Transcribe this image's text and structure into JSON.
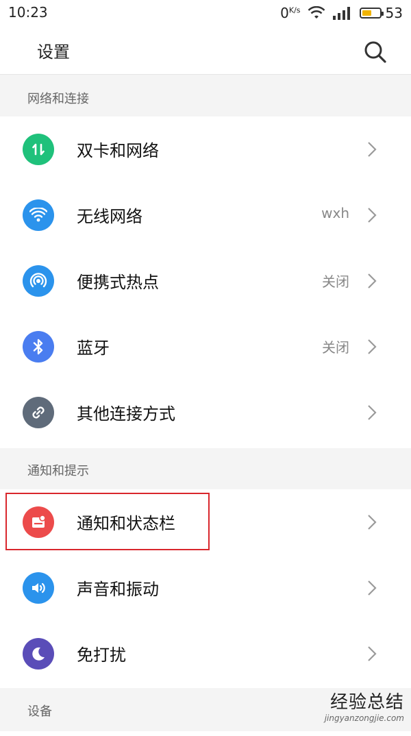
{
  "status_bar": {
    "time": "10:23",
    "network_speed": "0",
    "network_unit": "K/s",
    "battery_level": "53",
    "battery_fraction": 0.53,
    "battery_color": "#f1b400"
  },
  "header": {
    "title": "设置",
    "search_icon": "search-icon"
  },
  "sections": [
    {
      "title": "网络和连接",
      "items": [
        {
          "label": "双卡和网络",
          "value": "",
          "icon": "dual-sim-icon",
          "color": "#1fc17b"
        },
        {
          "label": "无线网络",
          "value": "wxh",
          "icon": "wifi-icon",
          "color": "#2b93ec"
        },
        {
          "label": "便携式热点",
          "value": "关闭",
          "icon": "hotspot-icon",
          "color": "#2b93ec"
        },
        {
          "label": "蓝牙",
          "value": "关闭",
          "icon": "bluetooth-icon",
          "color": "#4a7df0"
        },
        {
          "label": "其他连接方式",
          "value": "",
          "icon": "link-icon",
          "color": "#5f6b7a"
        }
      ]
    },
    {
      "title": "通知和提示",
      "items": [
        {
          "label": "通知和状态栏",
          "value": "",
          "icon": "notification-icon",
          "color": "#ec4b4b"
        },
        {
          "label": "声音和振动",
          "value": "",
          "icon": "sound-icon",
          "color": "#2b93ec"
        },
        {
          "label": "免打扰",
          "value": "",
          "icon": "moon-icon",
          "color": "#5a4db8"
        }
      ]
    },
    {
      "title": "设备",
      "items": []
    }
  ],
  "watermark": {
    "main": "经验总结",
    "sub": "jingyanzongjie.com"
  }
}
